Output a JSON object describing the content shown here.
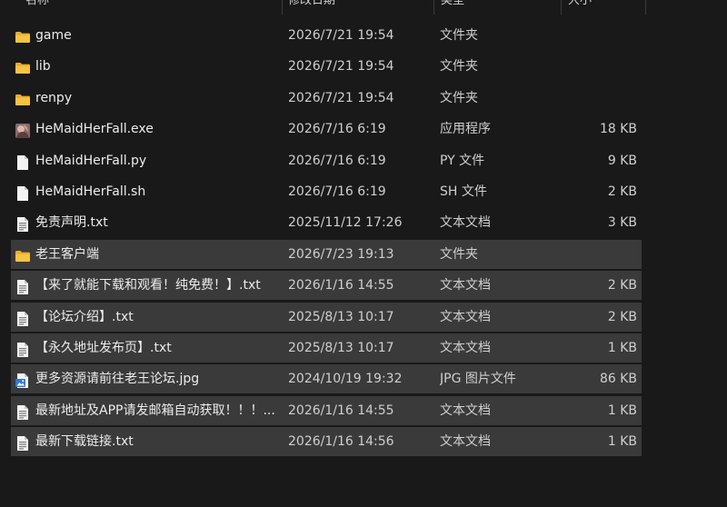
{
  "columns": {
    "name": "名称",
    "date": "修改日期",
    "type": "类型",
    "size": "大小"
  },
  "files": [
    {
      "icon": "folder",
      "name": "game",
      "date": "2026/7/21 19:54",
      "type": "文件夹",
      "size": "",
      "selected": false
    },
    {
      "icon": "folder",
      "name": "lib",
      "date": "2026/7/21 19:54",
      "type": "文件夹",
      "size": "",
      "selected": false
    },
    {
      "icon": "folder",
      "name": "renpy",
      "date": "2026/7/21 19:54",
      "type": "文件夹",
      "size": "",
      "selected": false
    },
    {
      "icon": "exe",
      "name": "HeMaidHerFall.exe",
      "date": "2026/7/16 6:19",
      "type": "应用程序",
      "size": "18 KB",
      "selected": false
    },
    {
      "icon": "blank",
      "name": "HeMaidHerFall.py",
      "date": "2026/7/16 6:19",
      "type": "PY 文件",
      "size": "9 KB",
      "selected": false
    },
    {
      "icon": "blank",
      "name": "HeMaidHerFall.sh",
      "date": "2026/7/16 6:19",
      "type": "SH 文件",
      "size": "2 KB",
      "selected": false
    },
    {
      "icon": "text",
      "name": "免责声明.txt",
      "date": "2025/11/12 17:26",
      "type": "文本文档",
      "size": "3 KB",
      "selected": false
    },
    {
      "icon": "folder",
      "name": "老王客户端",
      "date": "2026/7/23 19:13",
      "type": "文件夹",
      "size": "",
      "selected": true
    },
    {
      "icon": "text",
      "name": "【来了就能下载和观看！纯免费！】.txt",
      "date": "2026/1/16 14:55",
      "type": "文本文档",
      "size": "2 KB",
      "selected": true
    },
    {
      "icon": "text",
      "name": "【论坛介绍】.txt",
      "date": "2025/8/13 10:17",
      "type": "文本文档",
      "size": "2 KB",
      "selected": true
    },
    {
      "icon": "text",
      "name": "【永久地址发布页】.txt",
      "date": "2025/8/13 10:17",
      "type": "文本文档",
      "size": "1 KB",
      "selected": true
    },
    {
      "icon": "jpg",
      "name": "更多资源请前往老王论坛.jpg",
      "date": "2024/10/19 19:32",
      "type": "JPG 图片文件",
      "size": "86 KB",
      "selected": true
    },
    {
      "icon": "text",
      "name": "最新地址及APP请发邮箱自动获取！！！...",
      "date": "2026/1/16 14:55",
      "type": "文本文档",
      "size": "1 KB",
      "selected": true
    },
    {
      "icon": "text",
      "name": "最新下载链接.txt",
      "date": "2026/1/16 14:56",
      "type": "文本文档",
      "size": "1 KB",
      "selected": true
    }
  ],
  "icon_names": {
    "folder": "folder-icon",
    "exe": "application-icon",
    "blank": "blank-file-icon",
    "text": "text-document-icon",
    "jpg": "image-file-icon"
  },
  "colors": {
    "background": "#191919",
    "selection": "#3a3a3a",
    "folder": "#f6c443"
  }
}
